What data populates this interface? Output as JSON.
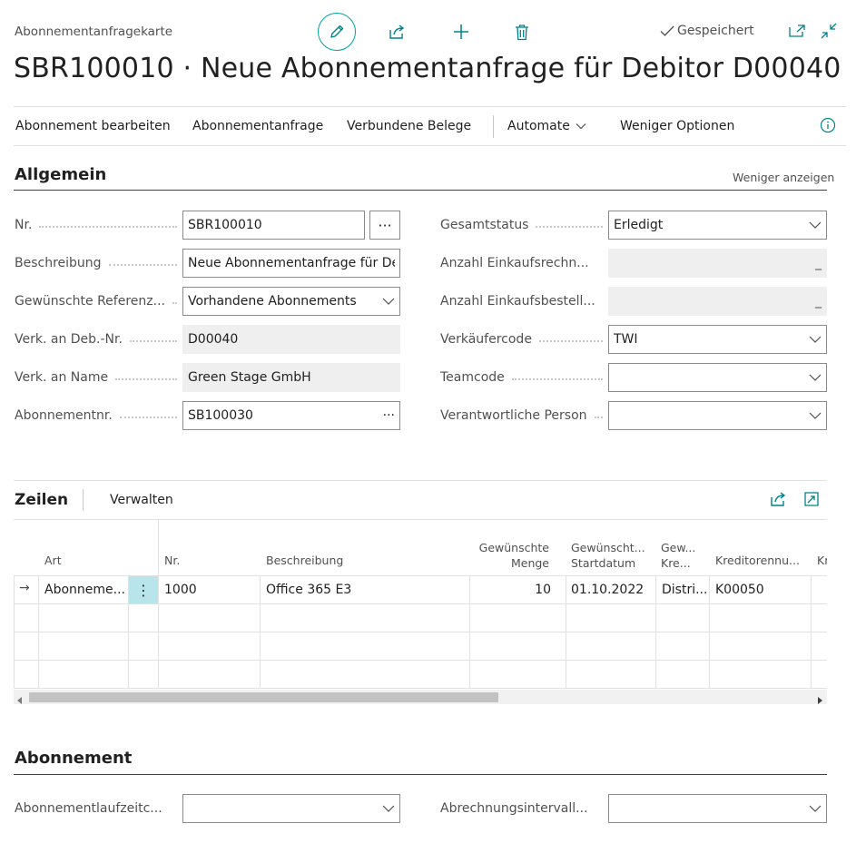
{
  "header": {
    "caption": "Abonnementanfragekarte",
    "title": "SBR100010 · Neue Abonnementanfrage für Debitor D00040",
    "saved_label": "Gespeichert",
    "icons": {
      "edit": "pencil-icon",
      "share": "share-icon",
      "new": "plus-icon",
      "delete": "trash-icon",
      "saved": "checkmark-icon",
      "open_new_window": "open-new-window-icon",
      "collapse": "collapse-icon"
    }
  },
  "actions": {
    "edit_subscription": "Abonnement bearbeiten",
    "subscription_request": "Abonnementanfrage",
    "related_documents": "Verbundene Belege",
    "automate": "Automate",
    "fewer_options": "Weniger Optionen",
    "info_icon": "info-icon"
  },
  "general": {
    "title": "Allgemein",
    "show_less": "Weniger anzeigen",
    "left_fields": [
      {
        "label": "Nr.",
        "value": "SBR100010"
      },
      {
        "label": "Beschreibung",
        "value": "Neue Abonnementanfrage für Del"
      },
      {
        "label": "Gewünschte Referenz...",
        "value": "Vorhandene Abonnements"
      },
      {
        "label": "Verk. an Deb.-Nr.",
        "value": "D00040"
      },
      {
        "label": "Verk. an Name",
        "value": "Green Stage GmbH"
      },
      {
        "label": "Abonnementnr.",
        "value": "SB100030"
      }
    ],
    "right_fields": [
      {
        "label": "Gesamtstatus",
        "value": "Erledigt"
      },
      {
        "label": "Anzahl Einkaufsrechn...",
        "value": "_"
      },
      {
        "label": "Anzahl Einkaufsbestell...",
        "value": "_"
      },
      {
        "label": "Verkäufercode",
        "value": "TWI"
      },
      {
        "label": "Teamcode",
        "value": ""
      },
      {
        "label": "Verantwortliche Person",
        "value": ""
      }
    ],
    "assist_glyph": "···"
  },
  "lines": {
    "title": "Zeilen",
    "manage": "Verwalten",
    "columns": {
      "art": "Art",
      "nr": "Nr.",
      "beschreibung": "Beschreibung",
      "menge_1": "Gewünschte",
      "menge_2": "Menge",
      "start_1": "Gewünscht...",
      "start_2": "Startdatum",
      "kre_1": "Gew...",
      "kre_2": "Kre...",
      "kreditor": "Kreditorennu...",
      "next": "Kr"
    },
    "row": {
      "art": "Abonneme...",
      "nr": "1000",
      "beschreibung": "Office 365 E3",
      "menge": "10",
      "startdatum": "01.10.2022",
      "kre": "Distri...",
      "kreditor": "K00050",
      "pointer": "→",
      "more": "⋮"
    }
  },
  "subscription": {
    "title": "Abonnement",
    "left_label": "Abonnementlaufzeitc...",
    "left_value": "",
    "right_label": "Abrechnungsintervall...",
    "right_value": ""
  }
}
